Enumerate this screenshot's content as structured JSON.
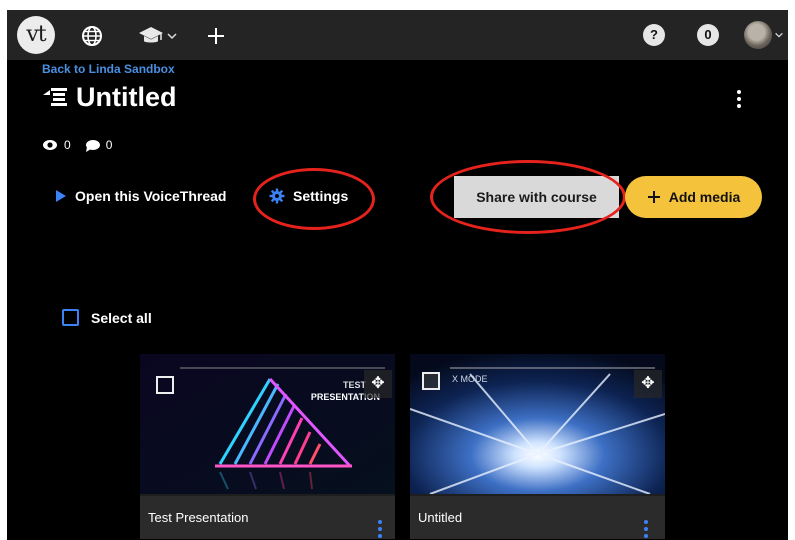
{
  "topbar": {
    "logo_text": "vt",
    "help_badge": "?",
    "notifications_count": "0",
    "icons": [
      "globe-icon",
      "graduation-cap-icon",
      "chevron-down-icon",
      "plus-icon",
      "user-avatar",
      "chevron-down-icon"
    ]
  },
  "header": {
    "back_link": "Back to Linda Sandbox",
    "title": "Untitled",
    "views": "0",
    "comments": "0"
  },
  "actions": {
    "open_label": "Open this VoiceThread",
    "settings_label": "Settings",
    "share_label": "Share with course",
    "add_media_label": "Add media"
  },
  "select_all_label": "Select all",
  "cards": [
    {
      "title": "Test Presentation",
      "thumb_text_1": "TEST",
      "thumb_text_2": "PRESENTATION"
    },
    {
      "title": "Untitled",
      "thumb_text_1": "X MODE"
    }
  ],
  "colors": {
    "topbar_bg": "#242424",
    "link_blue": "#4a90e2",
    "add_media_yellow": "#f5c33b",
    "annotation_red": "#e5231c",
    "checkbox_blue": "#3b82f6"
  }
}
